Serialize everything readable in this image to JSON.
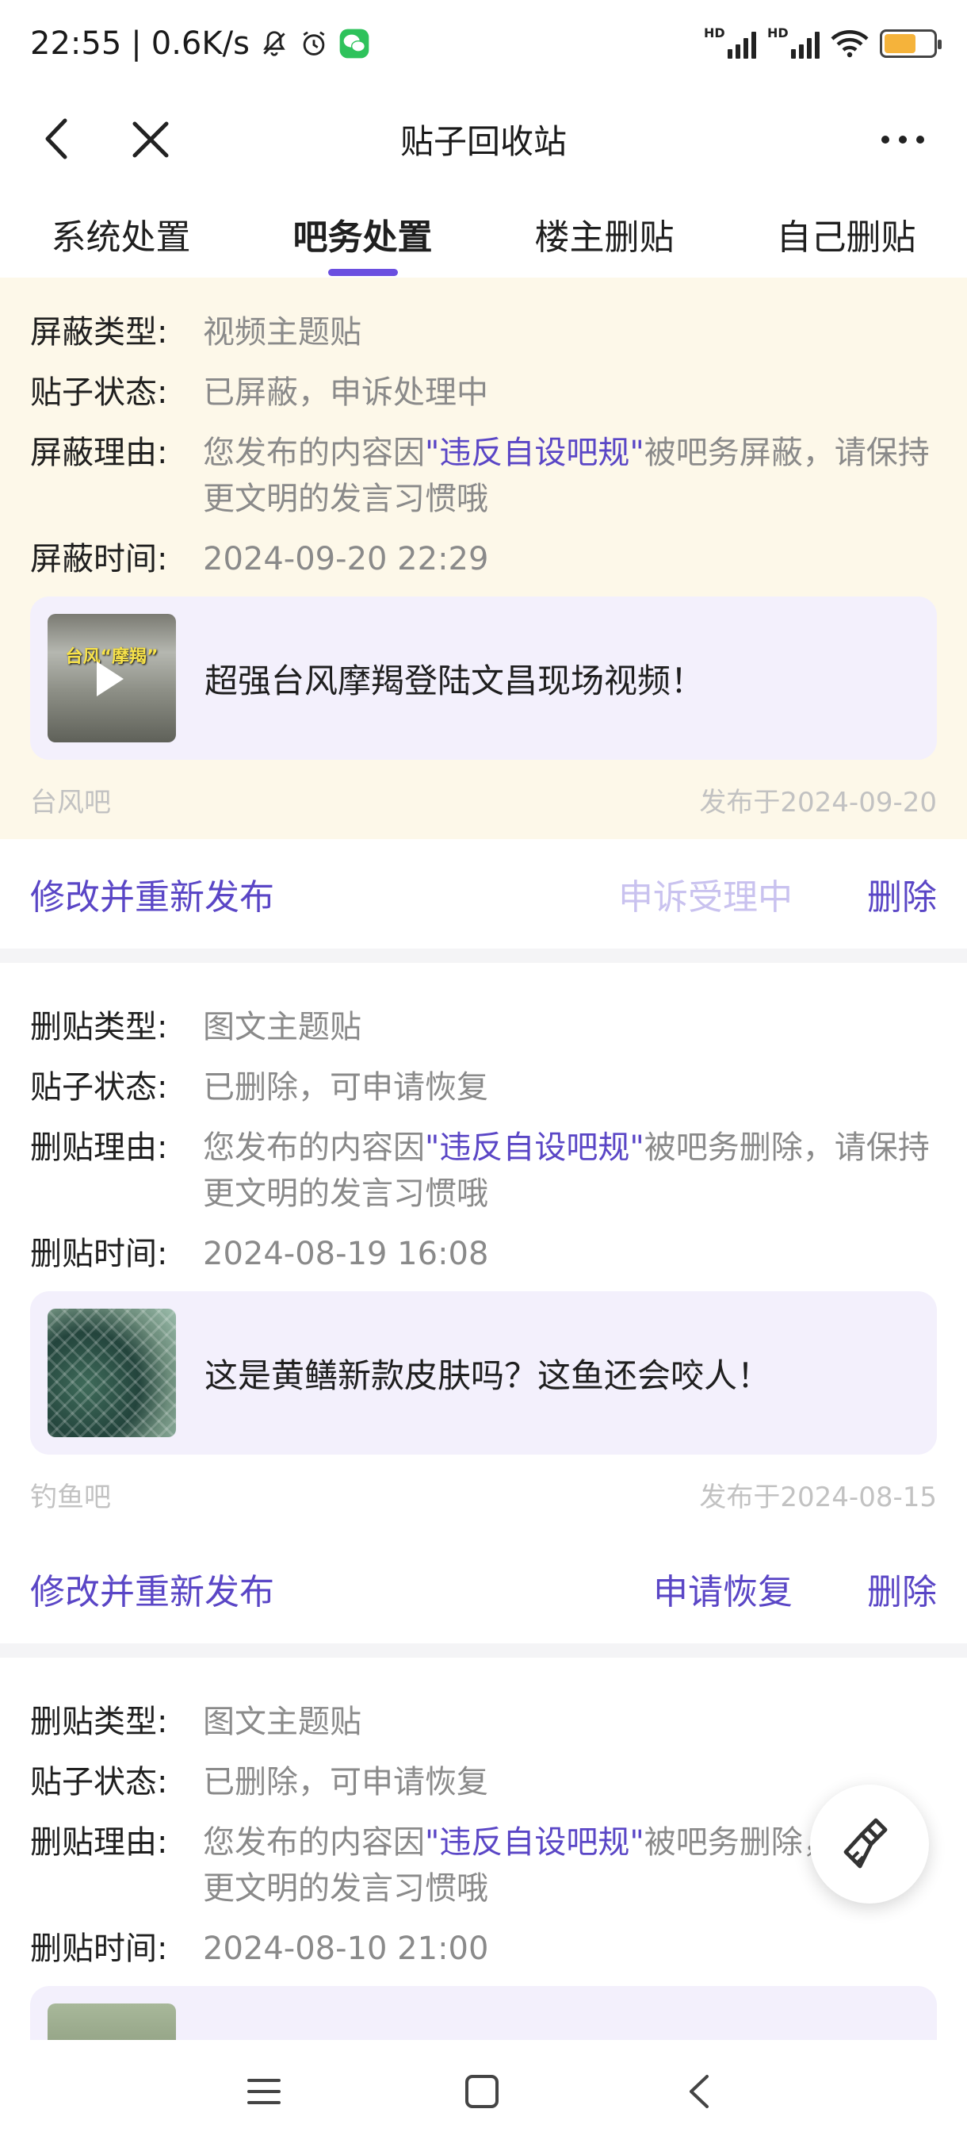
{
  "status_bar": {
    "time": "22:55",
    "separator": "|",
    "net_speed": "0.6K/s",
    "icons": [
      "bell-off-icon",
      "alarm-icon",
      "wechat-icon",
      "signal-hd-icon",
      "signal-hd-icon",
      "wifi-icon",
      "battery-icon"
    ],
    "hd_label": "HD",
    "battery_level": 0.65,
    "battery_color": "#f5b33b"
  },
  "nav": {
    "title": "贴子回收站",
    "back_icon": "chevron-left-icon",
    "close_icon": "close-icon",
    "more_icon": "more-horizontal-icon"
  },
  "tabs": [
    {
      "label": "系统处置",
      "active": false
    },
    {
      "label": "吧务处置",
      "active": true
    },
    {
      "label": "楼主删贴",
      "active": false
    },
    {
      "label": "自己删贴",
      "active": false
    }
  ],
  "accent_color": "#6b4fe0",
  "cards": [
    {
      "type_label": "屏蔽类型:",
      "type_value": "视频主题贴",
      "status_label": "贴子状态:",
      "status_value": "已屏蔽，申诉处理中",
      "reason_label": "屏蔽理由:",
      "reason_prefix": "您发布的内容因",
      "reason_link": "\"违反自设吧规\"",
      "reason_suffix": "被吧务屏蔽，请保持更文明的发言习惯哦",
      "time_label": "屏蔽时间:",
      "time_value": "2024-09-20 22:29",
      "post_title": "超强台风摩羯登陆文昌现场视频！",
      "thumb_text": "台风“摩羯”",
      "forum": "台风吧",
      "published": "发布于2024-09-20",
      "action_edit": "修改并重新发布",
      "action_mid": "申诉受理中",
      "action_delete": "删除"
    },
    {
      "type_label": "删贴类型:",
      "type_value": "图文主题贴",
      "status_label": "贴子状态:",
      "status_value": "已删除，可申请恢复",
      "reason_label": "删贴理由:",
      "reason_prefix": "您发布的内容因",
      "reason_link": "\"违反自设吧规\"",
      "reason_suffix": "被吧务删除，请保持更文明的发言习惯哦",
      "time_label": "删贴时间:",
      "time_value": "2024-08-19 16:08",
      "post_title": "这是黄鳝新款皮肤吗？这鱼还会咬人！",
      "forum": "钓鱼吧",
      "published": "发布于2024-08-15",
      "action_edit": "修改并重新发布",
      "action_mid": "申请恢复",
      "action_delete": "删除"
    },
    {
      "type_label": "删贴类型:",
      "type_value": "图文主题贴",
      "status_label": "贴子状态:",
      "status_value": "已删除，可申请恢复",
      "reason_label": "删贴理由:",
      "reason_prefix": "您发布的内容因",
      "reason_link": "\"违反自设吧规\"",
      "reason_suffix": "被吧务删除，请保持更文明的发言习惯哦",
      "time_label": "删贴时间:",
      "time_value": "2024-08-10 21:00"
    }
  ],
  "fab_icon": "broom-icon",
  "bottom_nav": {
    "menu_icon": "menu-icon",
    "home_icon": "square-home-icon",
    "back_icon": "triangle-back-icon"
  }
}
